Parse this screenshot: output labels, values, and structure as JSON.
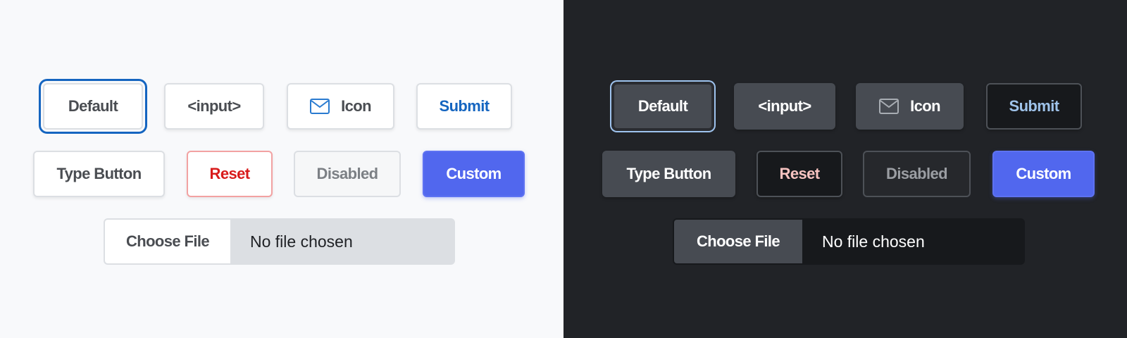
{
  "themes": {
    "light": {
      "buttons": {
        "default_label": "Default",
        "input_label": "<input>",
        "icon_label": "Icon",
        "icon_name": "envelope-icon",
        "submit_label": "Submit",
        "type_button_label": "Type Button",
        "reset_label": "Reset",
        "disabled_label": "Disabled",
        "custom_label": "Custom"
      },
      "file_input": {
        "button_label": "Choose File",
        "status_text": "No file chosen"
      }
    },
    "dark": {
      "buttons": {
        "default_label": "Default",
        "input_label": "<input>",
        "icon_label": "Icon",
        "icon_name": "envelope-icon",
        "submit_label": "Submit",
        "type_button_label": "Type Button",
        "reset_label": "Reset",
        "disabled_label": "Disabled",
        "custom_label": "Custom"
      },
      "file_input": {
        "button_label": "Choose File",
        "status_text": "No file chosen"
      }
    }
  },
  "colors": {
    "light_background": "#f8f9fb",
    "dark_background": "#212327",
    "focus_ring_light": "#1565c0",
    "focus_ring_dark": "#9ec3ee",
    "submit_text_light": "#1565c0",
    "reset_text_light": "#d81b1b",
    "custom_button": "#5167ee"
  }
}
